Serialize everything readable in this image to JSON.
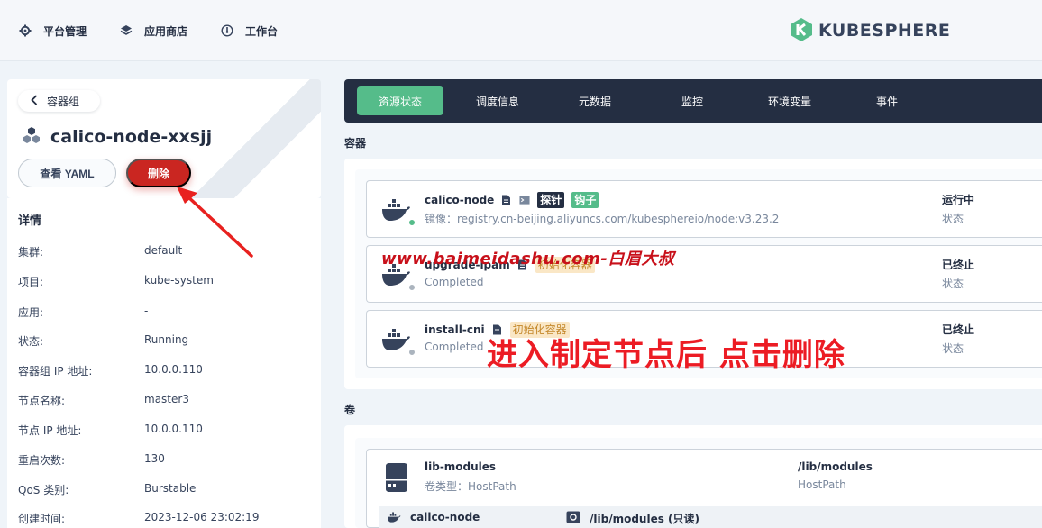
{
  "nav": {
    "platform": "平台管理",
    "appstore": "应用商店",
    "workbench": "工作台",
    "logo_text": "KUBESPHERE"
  },
  "left": {
    "back_label": "容器组",
    "pod_name": "calico-node-xxsjj",
    "yaml_button": "查看 YAML",
    "delete_button": "删除",
    "details_title": "详情",
    "details": [
      {
        "key": "集群:",
        "value": "default"
      },
      {
        "key": "项目:",
        "value": "kube-system"
      },
      {
        "key": "应用:",
        "value": "-"
      },
      {
        "key": "状态:",
        "value": "Running"
      },
      {
        "key": "容器组 IP 地址:",
        "value": "10.0.0.110"
      },
      {
        "key": "节点名称:",
        "value": "master3"
      },
      {
        "key": "节点 IP 地址:",
        "value": "10.0.0.110"
      },
      {
        "key": "重启次数:",
        "value": "130"
      },
      {
        "key": "QoS 类别:",
        "value": "Burstable"
      },
      {
        "key": "创建时间:",
        "value": "2023-12-06 23:02:19"
      }
    ]
  },
  "tabs": [
    "资源状态",
    "调度信息",
    "元数据",
    "监控",
    "环境变量",
    "事件"
  ],
  "containers_label": "容器",
  "containers": [
    {
      "name": "calico-node",
      "sub": "镜像：registry.cn-beijing.aliyuncs.com/kubesphereio/node:v3.23.2",
      "status": "运行中",
      "status_label": "状态",
      "tag1": "探针",
      "tag2": "钩子"
    },
    {
      "name": "upgrade-ipam",
      "sub": "Completed",
      "status": "已终止",
      "status_label": "状态",
      "tag1": "初始化容器"
    },
    {
      "name": "install-cni",
      "sub": "Completed",
      "status": "已终止",
      "status_label": "状态",
      "tag1": "初始化容器"
    }
  ],
  "volumes_label": "卷",
  "volume": {
    "name": "lib-modules",
    "type": "卷类型：HostPath",
    "path": "/lib/modules",
    "path_type": "HostPath",
    "mount_container": "calico-node",
    "mount_path": "/lib/modules (只读)"
  },
  "overlay": {
    "watermark": "www.baimeidashu.com-白眉大叔",
    "annotation": "进入制定节点后  点击删除"
  },
  "colors": {
    "accent_green": "#55bc8a",
    "dark_nav": "#242e42",
    "danger_red": "#ca2621",
    "annotation_red": "#ec1c24"
  }
}
